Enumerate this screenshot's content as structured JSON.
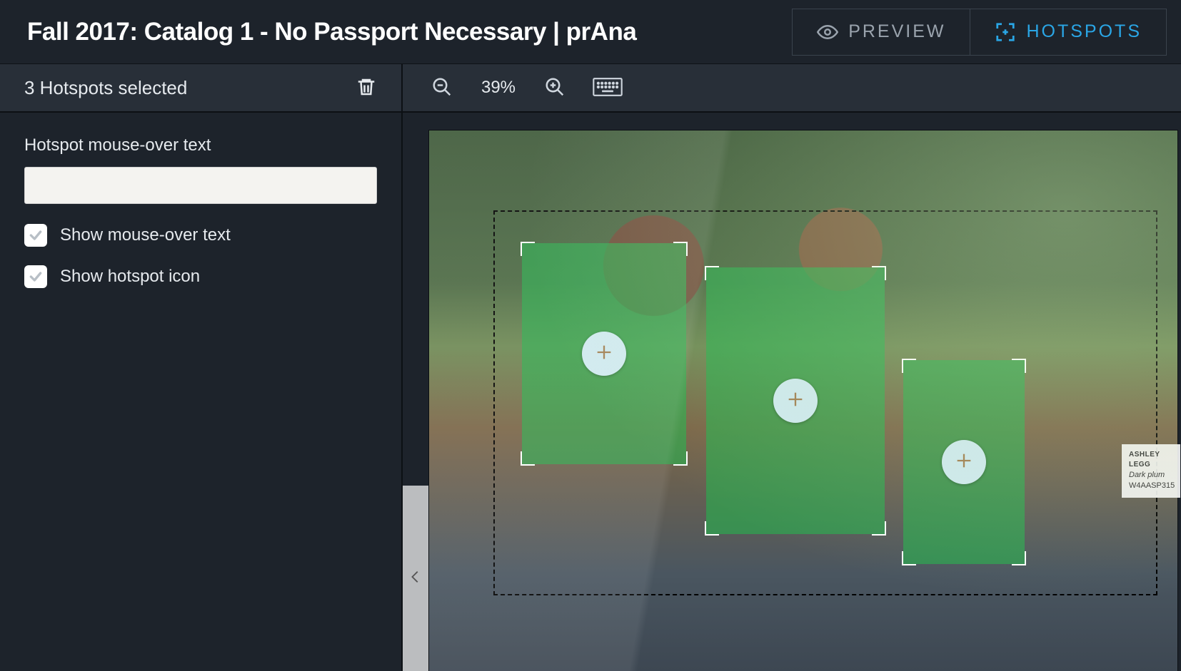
{
  "header": {
    "title": "Fall 2017: Catalog 1 - No Passport Necessary | prAna",
    "preview_label": "PREVIEW",
    "hotspots_label": "HOTSPOTS"
  },
  "sidebar": {
    "selection_text": "3 Hotspots selected",
    "mouseover_label": "Hotspot mouse-over text",
    "mouseover_value": "",
    "show_mouseover_label": "Show mouse-over text",
    "show_icon_label": "Show hotspot icon",
    "show_mouseover_checked": true,
    "show_icon_checked": true
  },
  "canvas": {
    "zoom_level": "39%",
    "product_label": {
      "name": "ASHLEY LEGG",
      "color": "Dark plum",
      "sku": "W4AASP315"
    }
  }
}
